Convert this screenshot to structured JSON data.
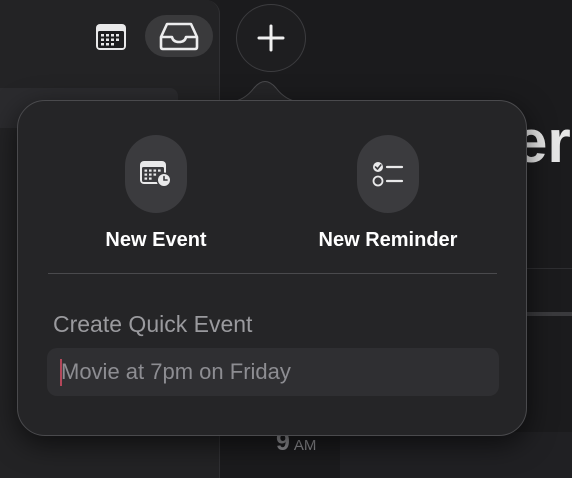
{
  "toolbar": {
    "calendar_icon": "calendar-grid-icon",
    "inbox_icon": "inbox-tray-icon",
    "add_icon": "plus-icon"
  },
  "background": {
    "heading_fragment": "er",
    "hour": "9",
    "meridiem": "AM"
  },
  "popover": {
    "actions": [
      {
        "label": "New Event",
        "icon": "calendar-clock-icon"
      },
      {
        "label": "New Reminder",
        "icon": "checklist-icon"
      }
    ],
    "quick_event": {
      "title": "Create Quick Event",
      "placeholder": "Movie at 7pm on Friday",
      "value": ""
    }
  },
  "colors": {
    "background": "#1c1c1e",
    "popover": "#252527",
    "button_fill": "#3b3b3e",
    "caret": "#b3475a"
  }
}
